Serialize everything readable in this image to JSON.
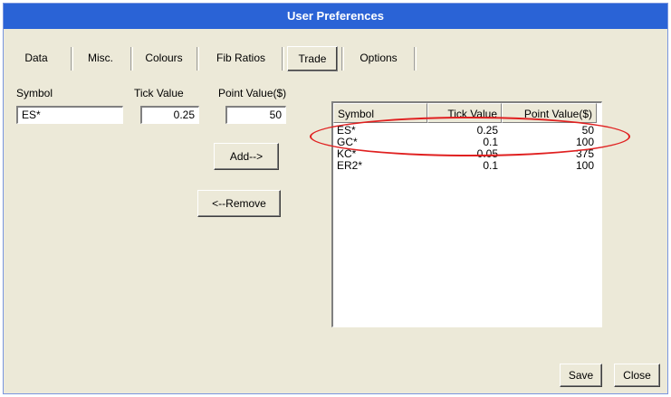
{
  "window": {
    "title": "User Preferences"
  },
  "tabs": [
    {
      "label": "Data"
    },
    {
      "label": "Misc."
    },
    {
      "label": "Colours"
    },
    {
      "label": "Fib Ratios"
    },
    {
      "label": "Trade",
      "active": true
    },
    {
      "label": "Options"
    }
  ],
  "form": {
    "symbol_label": "Symbol",
    "symbol_value": "ES*",
    "tick_label": "Tick Value",
    "tick_value": "0.25",
    "point_label": "Point Value($)",
    "point_value": "50"
  },
  "buttons": {
    "add": "Add-->",
    "remove": "<--Remove",
    "save": "Save",
    "close": "Close"
  },
  "list": {
    "columns": [
      "Symbol",
      "Tick Value",
      "Point Value($)"
    ],
    "rows": [
      {
        "symbol": "ES*",
        "tick": "0.25",
        "point": "50",
        "highlighted": true
      },
      {
        "symbol": "GC*",
        "tick": "0.1",
        "point": "100"
      },
      {
        "symbol": "KC*",
        "tick": "0.05",
        "point": "375"
      },
      {
        "symbol": "ER2*",
        "tick": "0.1",
        "point": "100"
      }
    ]
  },
  "colors": {
    "titlebar": "#2a63d6",
    "highlight": "#e02020",
    "dialog": "#ece9d8"
  }
}
